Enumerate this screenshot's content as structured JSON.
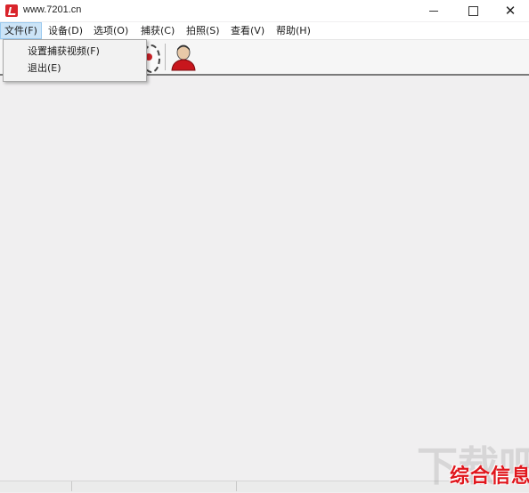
{
  "window": {
    "title": "www.7201.cn",
    "icon": "app-logo-icon",
    "controls": [
      "minimize-icon",
      "maximize-icon",
      "close-icon"
    ]
  },
  "menubar": {
    "items": [
      {
        "label": "文件(F)",
        "active": true
      },
      {
        "label": "设备(D)"
      },
      {
        "label": "选项(O)"
      },
      {
        "label": "捕获(C)"
      },
      {
        "label": "拍照(S)"
      },
      {
        "label": "查看(V)"
      },
      {
        "label": "帮助(H)"
      }
    ]
  },
  "file_menu": {
    "items": [
      {
        "label": "设置捕获视频(F)"
      },
      {
        "label": "退出(E)"
      }
    ]
  },
  "toolbar": {
    "icons": [
      "settings-gear-icon",
      "person-avatar-icon"
    ]
  },
  "watermark": {
    "text": "综合信息",
    "background_text": "下载吧"
  },
  "colors": {
    "accent_red": "#d9242b",
    "menu_highlight": "#cce4f7",
    "client_background": "#f0eff0"
  }
}
